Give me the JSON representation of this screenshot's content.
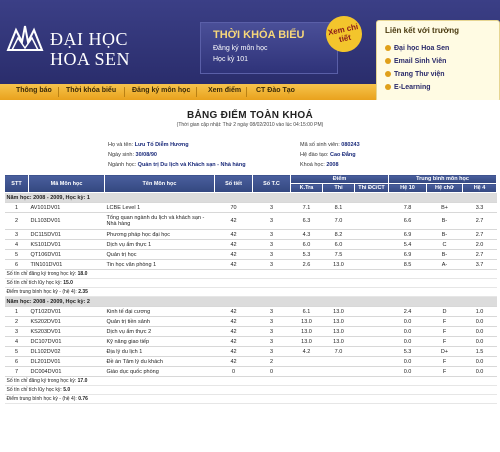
{
  "header": {
    "logo_line1": "ĐẠI HỌC",
    "logo_line2": "HOA SEN",
    "promo": {
      "title": "THỜI KHÓA BIỂU",
      "line1": "Đăng ký môn học",
      "line2": "Học kỳ 101",
      "badge": "Xem chi tiết"
    },
    "links_box": {
      "title": "Liên kết với trường",
      "items": [
        "Đại học Hoa Sen",
        "Email Sinh Viên",
        "Trang Thư viện",
        "E-Learning"
      ]
    }
  },
  "nav": [
    "Thông báo",
    "Thời khóa biểu",
    "Đăng ký môn học",
    "Xem điểm",
    "CT Đào Tạo"
  ],
  "page": {
    "title": "BẢNG ĐIỂM TOÀN KHOÁ",
    "updated": "(Thời gian cập nhật: Thứ 2 ngày 08/02/2010 vào lúc 04:15:00 PM)",
    "student": {
      "name_label": "Họ và tên:",
      "name": "Lưu Tố Diễm Hương",
      "dob_label": "Ngày sinh:",
      "dob": "30/08/90",
      "major_label": "Ngành học:",
      "major": "Quản trị Du lịch và Khách sạn - Nhà hàng",
      "id_label": "Mã số sinh viên:",
      "id": "080243",
      "level_label": "Hệ đào tạo:",
      "level": "Cao Đẳng",
      "cohort_label": "Khoá học:",
      "cohort": "2008"
    }
  },
  "table": {
    "headers": {
      "stt": "STT",
      "code": "Mã Môn học",
      "name": "Tên Môn học",
      "periods": "Số tiết",
      "credits": "Số T.C",
      "score_group": "Điểm",
      "ktra": "K.Tra",
      "thi": "Thi",
      "thi_dc": "Thi ĐC/CT",
      "avg_group": "Trung bình môn học",
      "he10": "Hệ 10",
      "hechu": "Hệ chữ",
      "he4": "Hệ 4"
    },
    "semester1": {
      "label": "Năm học: 2008 - 2009, Học kỳ: 1",
      "rows": [
        [
          "1",
          "AV101DV01",
          "LCBE Level 1",
          "70",
          "3",
          "7.1",
          "8.1",
          "",
          "7.8",
          "B+",
          "3.3"
        ],
        [
          "2",
          "DL103DV01",
          "Tổng quan ngành du lịch và khách sạn - Nhà hàng",
          "42",
          "3",
          "6.3",
          "7.0",
          "",
          "6.6",
          "B-",
          "2.7"
        ],
        [
          "3",
          "DC115DV01",
          "Phương pháp học đại học",
          "42",
          "3",
          "4.3",
          "8.2",
          "",
          "6.9",
          "B-",
          "2.7"
        ],
        [
          "4",
          "KS101DV01",
          "Dịch vụ ẩm thực 1",
          "42",
          "3",
          "6.0",
          "6.0",
          "",
          "5.4",
          "C",
          "2.0"
        ],
        [
          "5",
          "QT106DV01",
          "Quản trị học",
          "42",
          "3",
          "5.3",
          "7.5",
          "",
          "6.9",
          "B-",
          "2.7"
        ],
        [
          "6",
          "TIN101DV01",
          "Tin học văn phòng 1",
          "42",
          "3",
          "2.6",
          "13.0",
          "",
          "8.5",
          "A-",
          "3.7"
        ]
      ],
      "summary": [
        [
          "Số tín chỉ đăng ký trong học kỳ:",
          "18.0"
        ],
        [
          "Số tín chỉ tích lũy học kỳ:",
          "15.0"
        ],
        [
          "Điểm trung bình học kỳ - (hệ 4):",
          "2.35"
        ]
      ]
    },
    "semester2": {
      "label": "Năm học: 2008 - 2009, Học kỳ: 2",
      "rows": [
        [
          "1",
          "QT102DV01",
          "Kinh tế đại cương",
          "42",
          "3",
          "6.1",
          "13.0",
          "",
          "2.4",
          "D",
          "1.0"
        ],
        [
          "2",
          "KS202DV01",
          "Quản trị tiền sảnh",
          "42",
          "3",
          "13.0",
          "13.0",
          "",
          "0.0",
          "F",
          "0.0"
        ],
        [
          "3",
          "KS203DV01",
          "Dịch vụ ẩm thực 2",
          "42",
          "3",
          "13.0",
          "13.0",
          "",
          "0.0",
          "F",
          "0.0"
        ],
        [
          "4",
          "DC107DV01",
          "Kỹ năng giao tiếp",
          "42",
          "3",
          "13.0",
          "13.0",
          "",
          "0.0",
          "F",
          "0.0"
        ],
        [
          "5",
          "DL102DV02",
          "Địa lý du lịch 1",
          "42",
          "3",
          "4.2",
          "7.0",
          "",
          "5.3",
          "D+",
          "1.5"
        ],
        [
          "6",
          "DL201DV01",
          "Đề án Tâm lý du khách",
          "42",
          "2",
          "",
          "",
          "",
          "0.0",
          "F",
          "0.0"
        ],
        [
          "7",
          "DC004DV01",
          "Giáo dục quốc phòng",
          "0",
          "0",
          "",
          "",
          "",
          "0.0",
          "F",
          "0.0"
        ]
      ],
      "summary": [
        [
          "Số tín chỉ đăng ký trong học kỳ:",
          "17.0"
        ],
        [
          "Số tín chỉ tích lũy học kỳ:",
          "5.0"
        ],
        [
          "Điểm trung bình học kỳ - (hệ 4):",
          "0.76"
        ]
      ]
    }
  }
}
